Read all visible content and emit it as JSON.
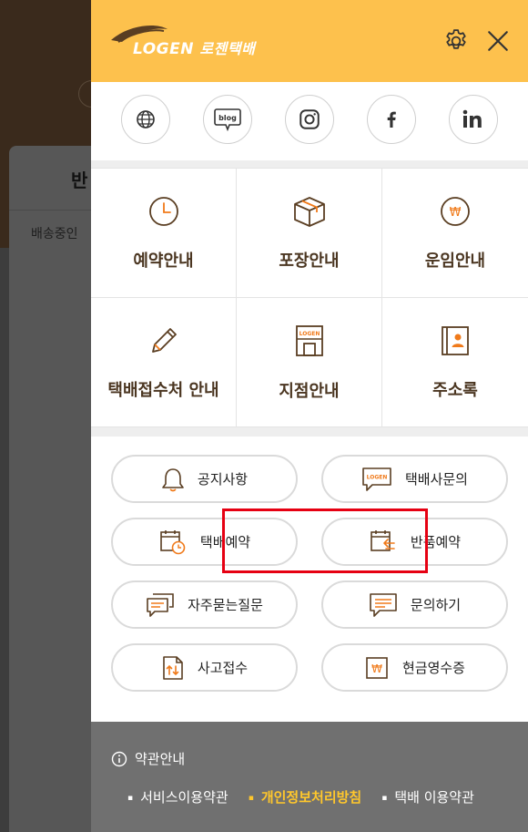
{
  "background": {
    "tab_label": "반",
    "sub_label": "배송중인"
  },
  "header": {
    "logo_en": "LOGEN",
    "logo_ko": "로젠택배",
    "settings_icon": "gear-icon",
    "close_icon": "close-icon"
  },
  "social": [
    {
      "name": "globe-icon"
    },
    {
      "name": "blog-icon",
      "text": "blog"
    },
    {
      "name": "instagram-icon"
    },
    {
      "name": "facebook-icon"
    },
    {
      "name": "linkedin-icon"
    }
  ],
  "grid": [
    {
      "label": "예약안내",
      "icon": "clock-icon"
    },
    {
      "label": "포장안내",
      "icon": "box-icon"
    },
    {
      "label": "운임안내",
      "icon": "won-coin-icon"
    },
    {
      "label": "택배접수처 안내",
      "icon": "pencil-icon"
    },
    {
      "label": "지점안내",
      "icon": "branch-store-icon",
      "icon_text": "LOGEN"
    },
    {
      "label": "주소록",
      "icon": "address-book-icon"
    }
  ],
  "buttons": [
    {
      "label": "공지사항",
      "icon": "bell-icon"
    },
    {
      "label": "택배사문의",
      "icon": "logen-chat-icon",
      "icon_text": "LOGEN"
    },
    {
      "label": "택배예약",
      "icon": "calendar-clock-icon"
    },
    {
      "label": "반품예약",
      "icon": "calendar-return-icon"
    },
    {
      "label": "자주묻는질문",
      "icon": "faq-chat-icon"
    },
    {
      "label": "문의하기",
      "icon": "inquiry-chat-icon"
    },
    {
      "label": "사고접수",
      "icon": "accident-report-icon"
    },
    {
      "label": "현금영수증",
      "icon": "cash-receipt-icon"
    }
  ],
  "footer": {
    "title": "약관안내",
    "links": [
      {
        "label": "서비스이용약관"
      },
      {
        "label": "개인정보처리방침",
        "highlighted": true
      },
      {
        "label": "택배 이용약관"
      }
    ]
  },
  "colors": {
    "header_bg": "#fdc14d",
    "accent_orange": "#f07a1a",
    "icon_brown": "#5a3e22",
    "highlight_box": "#e60012",
    "footer_bg": "#707070",
    "footer_highlight": "#ffc72c"
  }
}
